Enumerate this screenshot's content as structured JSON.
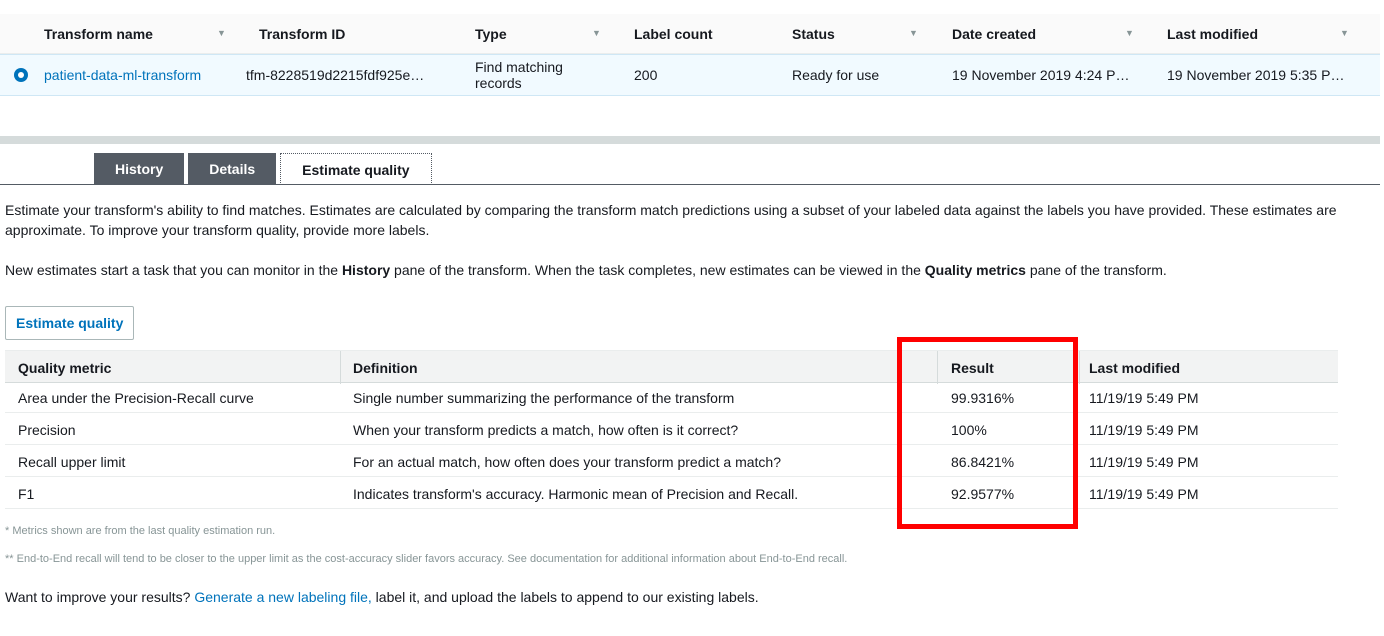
{
  "transforms_table": {
    "columns": [
      "Transform name",
      "Transform ID",
      "Type",
      "Label count",
      "Status",
      "Date created",
      "Last modified"
    ],
    "row": {
      "name": "patient-data-ml-transform",
      "id": "tfm-8228519d2215fdf925e…",
      "type": "Find matching records",
      "label_count": "200",
      "status": "Ready for use",
      "date_created": "19 November 2019 4:24 P…",
      "last_modified": "19 November 2019 5:35 P…"
    }
  },
  "tabs": [
    {
      "label": "History"
    },
    {
      "label": "Details"
    },
    {
      "label": "Estimate quality"
    }
  ],
  "intro": {
    "text": "Estimate your transform's ability to find matches. Estimates are calculated by comparing the transform match predictions using a subset of your labeled data against the labels you have provided. These estimates are approximate. To improve your transform quality, provide more labels."
  },
  "task_info": {
    "part1": "New estimates start a task that you can monitor in the ",
    "bold1": "History",
    "part2": " pane of the transform. When the task completes, new estimates can be viewed in the ",
    "bold2": "Quality metrics",
    "part3": " pane of the transform."
  },
  "estimate_button": "Estimate quality",
  "metrics_table": {
    "columns": [
      "Quality metric",
      "Definition",
      "Result",
      "Last modified"
    ],
    "rows": [
      {
        "metric": "Area under the Precision-Recall curve",
        "definition": "Single number summarizing the performance of the transform",
        "result": "99.9316%",
        "last_modified": "11/19/19 5:49 PM"
      },
      {
        "metric": "Precision",
        "definition": "When your transform predicts a match, how often is it correct?",
        "result": "100%",
        "last_modified": "11/19/19 5:49 PM"
      },
      {
        "metric": "Recall upper limit",
        "definition": "For an actual match, how often does your transform predict a match?",
        "result": "86.8421%",
        "last_modified": "11/19/19 5:49 PM"
      },
      {
        "metric": "F1",
        "definition": "Indicates transform's accuracy. Harmonic mean of Precision and Recall.",
        "result": "92.9577%",
        "last_modified": "11/19/19 5:49 PM"
      }
    ]
  },
  "notes": {
    "note1": "* Metrics shown are from the last quality estimation run.",
    "note2": "** End-to-End recall will tend to be closer to the upper limit as the cost-accuracy slider favors accuracy. See documentation for additional information about End-to-End recall."
  },
  "improve": {
    "prefix": "Want to improve your results? ",
    "link": "Generate a new labeling file,",
    "suffix": " label it, and upload the labels to append to our existing labels."
  },
  "colors": {
    "link": "#0073bb",
    "highlight": "#ff0000",
    "tab_dark": "#545b64"
  }
}
